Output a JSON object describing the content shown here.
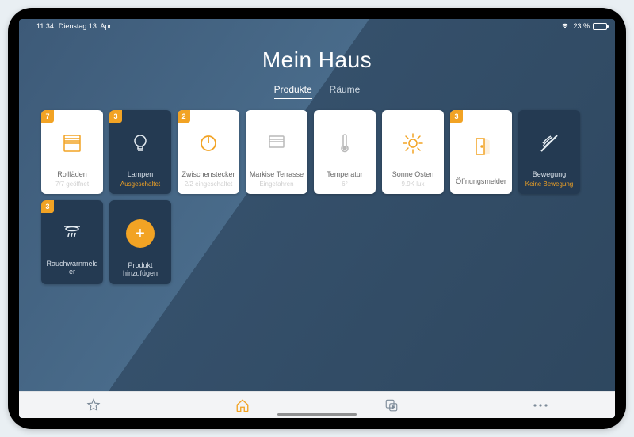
{
  "status": {
    "time": "11:34",
    "date": "Dienstag 13. Apr.",
    "battery_pct": "23 %"
  },
  "header": {
    "title": "Mein Haus",
    "tabs": {
      "products": "Produkte",
      "rooms": "Räume"
    }
  },
  "cards": {
    "shutters": {
      "badge": "7",
      "label": "Rollläden",
      "sub": "7/7 geöffnet"
    },
    "lamps": {
      "badge": "3",
      "label": "Lampen",
      "sub": "Ausgeschaltet"
    },
    "plugs": {
      "badge": "2",
      "label": "Zwischenstecker",
      "sub": "2/2 eingeschaltet"
    },
    "awning": {
      "label": "Markise Terrasse",
      "sub": "Eingefahren"
    },
    "temp": {
      "label": "Temperatur",
      "sub": "6°"
    },
    "sun": {
      "label": "Sonne Osten",
      "sub": "9.9K lux"
    },
    "opening": {
      "badge": "3",
      "label": "Öffnungsmelder",
      "sub": ""
    },
    "motion": {
      "label": "Bewegung",
      "sub": "Keine Bewegung"
    },
    "smoke": {
      "badge": "3",
      "label": "Rauchwarnmelder",
      "sub": ""
    },
    "add": {
      "label": "Produkt hinzufügen"
    }
  }
}
